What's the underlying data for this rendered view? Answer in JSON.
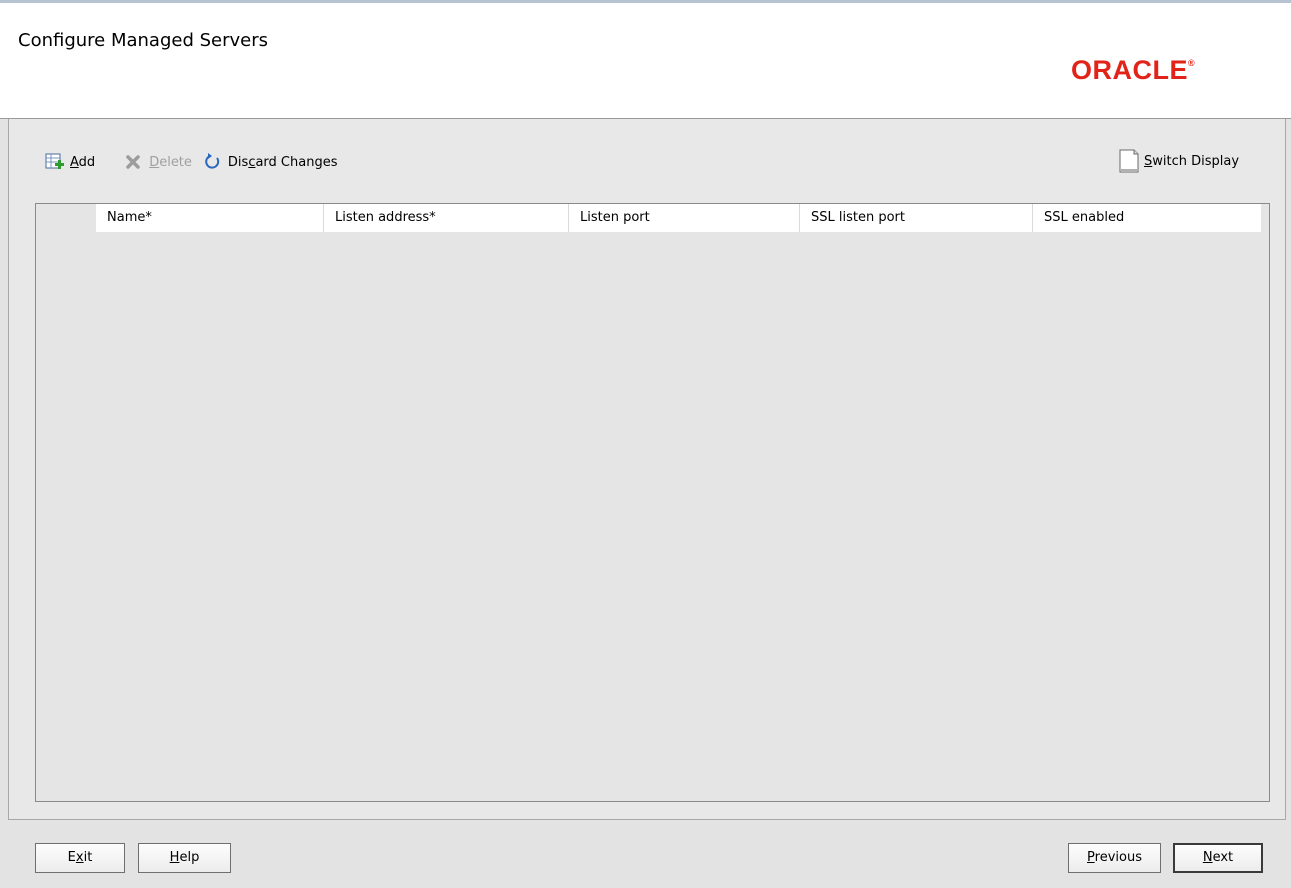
{
  "header": {
    "title": "Configure Managed Servers",
    "logo_text": "ORACLE",
    "logo_mark": "®",
    "logo_color": "#e2231a"
  },
  "toolbar": {
    "add": {
      "underline": "A",
      "rest": "dd",
      "icon": "add-row-icon"
    },
    "delete": {
      "underline": "D",
      "rest": "elete",
      "icon": "delete-x-icon",
      "enabled": false
    },
    "discard": {
      "before": "Dis",
      "underline": "c",
      "rest": "ard Changes",
      "icon": "refresh-icon"
    },
    "switch_display": {
      "underline": "S",
      "rest": "witch Display",
      "icon": "page-icon"
    }
  },
  "table": {
    "columns": [
      "Name*",
      "Listen address*",
      "Listen port",
      "SSL listen port",
      "SSL enabled"
    ],
    "rows": []
  },
  "footer": {
    "exit": {
      "before": "E",
      "underline": "x",
      "rest": "it"
    },
    "help": {
      "underline": "H",
      "rest": "elp"
    },
    "previous": {
      "underline": "P",
      "rest": "revious"
    },
    "next": {
      "underline": "N",
      "rest": "ext"
    }
  }
}
